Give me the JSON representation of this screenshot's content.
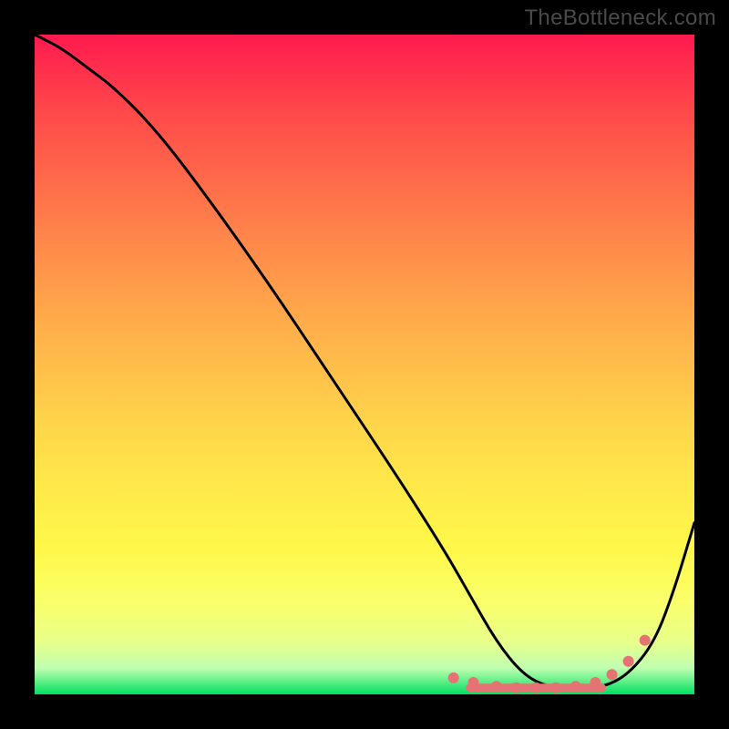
{
  "watermark": "TheBottleneck.com",
  "chart_data": {
    "type": "line",
    "title": "",
    "xlabel": "",
    "ylabel": "",
    "xlim": [
      0,
      100
    ],
    "ylim": [
      0,
      100
    ],
    "grid": false,
    "series": [
      {
        "name": "bottleneck-curve",
        "color": "#000000",
        "x": [
          0,
          4,
          8,
          12,
          18,
          25,
          35,
          45,
          55,
          62,
          66,
          70,
          74,
          78,
          82,
          86,
          90,
          94,
          97,
          100
        ],
        "y": [
          100,
          98,
          95,
          92,
          86,
          77,
          63,
          48,
          33,
          22,
          15,
          8,
          3,
          1,
          1,
          1,
          3,
          8,
          16,
          26
        ]
      }
    ],
    "markers": {
      "name": "highlight-dots",
      "color": "#e57373",
      "x": [
        63.5,
        66.5,
        70,
        73,
        76,
        79,
        82,
        85,
        87.5,
        90,
        92.5
      ],
      "y": [
        2.5,
        1.8,
        1.2,
        1.0,
        1.0,
        1.0,
        1.2,
        1.8,
        3.0,
        5.0,
        8.2
      ]
    },
    "marker_bar": {
      "color": "#e57373",
      "x_start": 66,
      "x_end": 86,
      "y": 1.0
    }
  }
}
